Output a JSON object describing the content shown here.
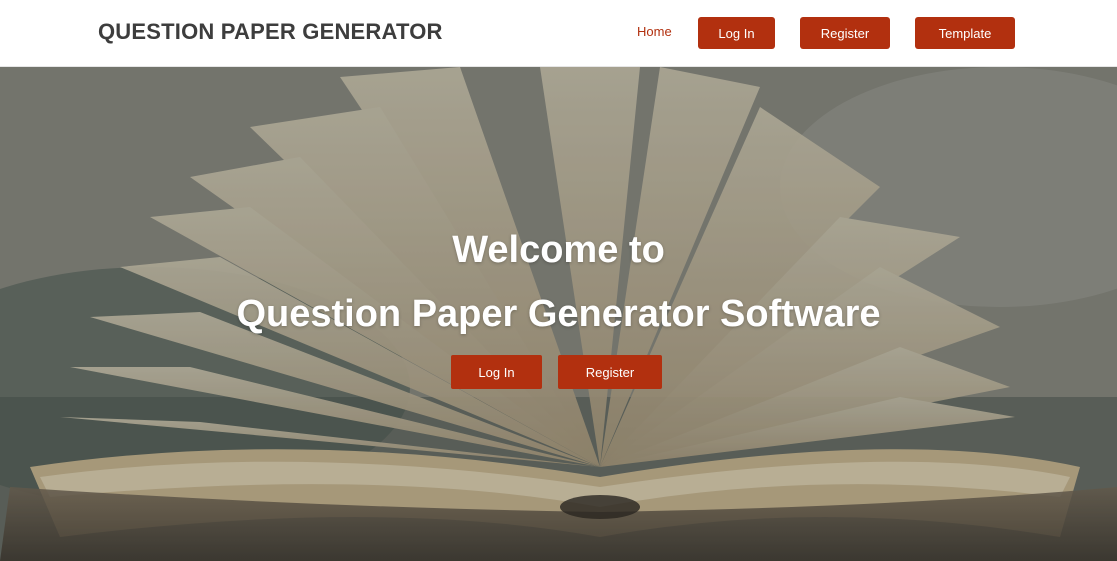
{
  "navbar": {
    "brand": "QUESTION PAPER GENERATOR",
    "home_label": "Home",
    "login_label": "Log In",
    "register_label": "Register",
    "template_label": "Template"
  },
  "hero": {
    "heading_line1": "Welcome to",
    "heading_line2": "Question Paper Generator Software",
    "login_label": "Log In",
    "register_label": "Register",
    "background": "open-book-photo"
  },
  "colors": {
    "accent": "#b2300f",
    "brand_text": "#3d3d3d",
    "hero_text": "#ffffff"
  }
}
